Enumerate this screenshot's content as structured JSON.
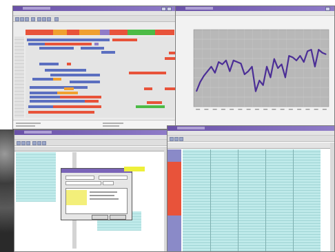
{
  "gantt_window": {
    "title": "",
    "status": ""
  },
  "chart_window": {
    "title": "",
    "chart_data": {
      "type": "line",
      "title": "",
      "xlabel": "",
      "ylabel": "",
      "values": [
        20,
        32,
        40,
        46,
        52,
        44,
        58,
        55,
        60,
        46,
        60,
        58,
        56,
        42,
        46,
        52,
        20,
        34,
        28,
        52,
        38,
        62,
        50,
        55,
        38,
        66,
        64,
        60,
        66,
        58,
        72,
        74,
        52,
        74,
        70,
        68
      ],
      "ylim": [
        0,
        100
      ],
      "grid": true,
      "series_color": "#4b2e96"
    }
  },
  "table_window": {
    "title": ""
  },
  "dialog": {
    "title": ""
  },
  "sheet_window": {
    "title": ""
  },
  "colors": {
    "gantt_blue": "#5b6fc0",
    "gantt_red": "#e8533a",
    "gantt_orange": "#f0a030",
    "gantt_green": "#4cbb46",
    "cell_cyan": "#bfeaea",
    "chart_bg": "#b8b8b8",
    "title_purple": "#7a64b8"
  }
}
